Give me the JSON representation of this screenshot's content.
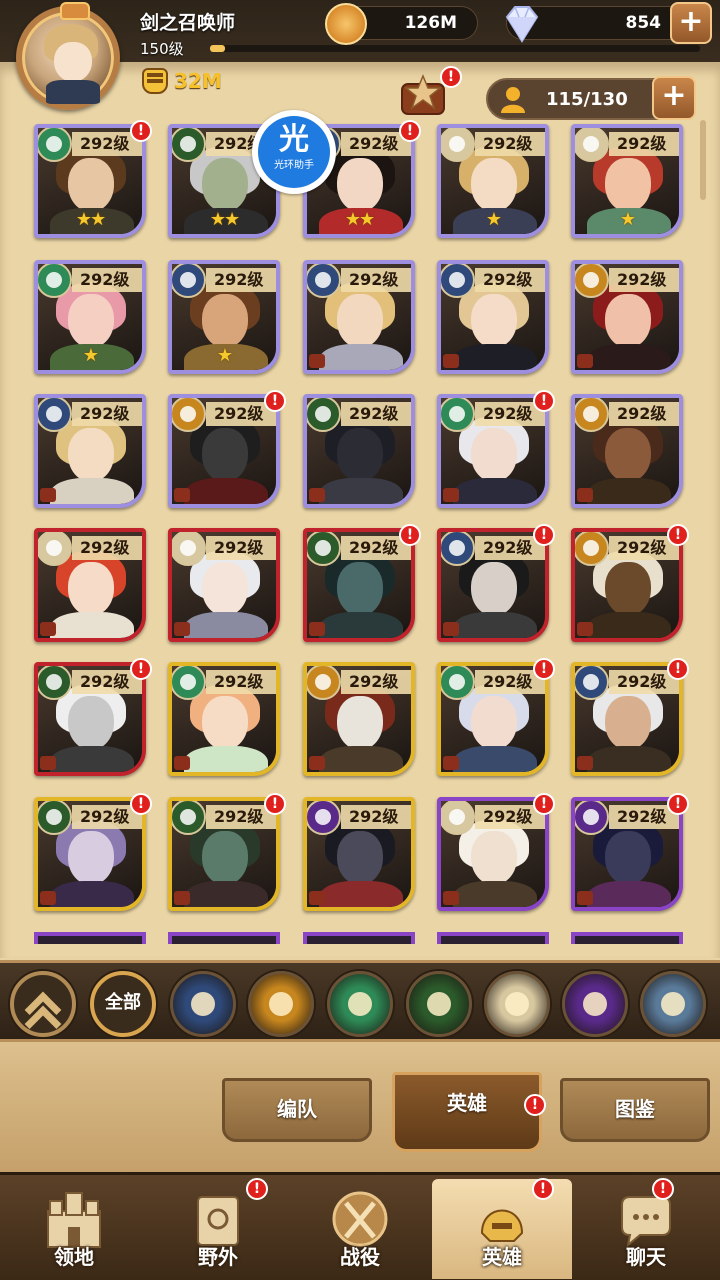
{
  "player": {
    "name": "剑之召唤师",
    "level": "150级",
    "xp_progress": 0.03,
    "power": "32M"
  },
  "currency": {
    "gold": "126M",
    "gems": "854"
  },
  "roster": {
    "capacity": "115/130"
  },
  "watermark": {
    "char": "光",
    "label": "光环助手"
  },
  "heroes": [
    {
      "level": "292级",
      "faction": "forest",
      "frame": "purple",
      "stars": "★★",
      "alert": true,
      "skin": "#e7c7a3",
      "hair": "#5b3a1e",
      "body": "#3d3a2c"
    },
    {
      "level": "292级",
      "faction": "hypogean-eye",
      "frame": "purple",
      "stars": "★★",
      "alert": false,
      "skin": "#a3b08e",
      "hair": "#c8c8c8",
      "body": "#2c2c2c"
    },
    {
      "level": "292级",
      "faction": "lightbearer",
      "frame": "purple",
      "stars": "★★",
      "alert": true,
      "skin": "#f1d7c4",
      "hair": "#1b1410",
      "body": "#b22a2a"
    },
    {
      "level": "292级",
      "faction": "celestial",
      "frame": "purple",
      "stars": "★",
      "alert": false,
      "skin": "#f3dcc3",
      "hair": "#d7b06a",
      "body": "#3a3f55"
    },
    {
      "level": "292级",
      "faction": "celestial",
      "frame": "purple",
      "stars": "★",
      "alert": false,
      "skin": "#f2c2a4",
      "hair": "#b73a2a",
      "body": "#5a8a6a"
    },
    {
      "level": "292级",
      "faction": "forest",
      "frame": "purple",
      "stars": "★",
      "alert": false,
      "skin": "#f5cfc2",
      "hair": "#e89aa8",
      "body": "#4a6a3a"
    },
    {
      "level": "292级",
      "faction": "lightbearer",
      "frame": "purple",
      "stars": "★",
      "alert": false,
      "skin": "#d8a57a",
      "hair": "#6a3e1e",
      "body": "#8a6a30"
    },
    {
      "level": "292级",
      "faction": "lightbearer",
      "frame": "purple",
      "stars": "",
      "alert": false,
      "skin": "#f3d8c0",
      "hair": "#e2c07a",
      "body": "#a8a8b8"
    },
    {
      "level": "292级",
      "faction": "lightbearer",
      "frame": "purple",
      "stars": "",
      "alert": false,
      "skin": "#f4dcc8",
      "hair": "#e2c693",
      "body": "#1e1e26"
    },
    {
      "level": "292级",
      "faction": "mauler",
      "frame": "purple",
      "stars": "",
      "alert": false,
      "skin": "#f0c0a8",
      "hair": "#8c1c1c",
      "body": "#2a1a1a"
    },
    {
      "level": "292级",
      "faction": "lightbearer",
      "frame": "purple",
      "stars": "",
      "alert": false,
      "skin": "#f4dcc2",
      "hair": "#e0c280",
      "body": "#d8d0c0"
    },
    {
      "level": "292级",
      "faction": "mauler",
      "frame": "purple",
      "stars": "",
      "alert": true,
      "skin": "#3a3a3a",
      "hair": "#1e1e1e",
      "body": "#5a1a1a"
    },
    {
      "level": "292级",
      "faction": "hypogean-eye",
      "frame": "purple",
      "stars": "",
      "alert": false,
      "skin": "#2c2c34",
      "hair": "#1e1e26",
      "body": "#3a3a44"
    },
    {
      "level": "292级",
      "faction": "forest",
      "frame": "purple",
      "stars": "",
      "alert": true,
      "skin": "#f2dcd0",
      "hair": "#e8e8ec",
      "body": "#2a2a3a"
    },
    {
      "level": "292级",
      "faction": "mauler",
      "frame": "purple",
      "stars": "",
      "alert": false,
      "skin": "#8a5a3a",
      "hair": "#4a2a1a",
      "body": "#3a2a1a"
    },
    {
      "level": "292级",
      "faction": "celestial",
      "frame": "red",
      "stars": "",
      "alert": false,
      "skin": "#f6dcc8",
      "hair": "#d8442a",
      "body": "#e8e0d0"
    },
    {
      "level": "292级",
      "faction": "celestial",
      "frame": "red",
      "stars": "",
      "alert": false,
      "skin": "#f4e4da",
      "hair": "#e8eaee",
      "body": "#8a8aa0"
    },
    {
      "level": "292级",
      "faction": "hypogean-eye",
      "frame": "red",
      "stars": "",
      "alert": true,
      "skin": "#4a6a6a",
      "hair": "#1a2a2a",
      "body": "#2a3a3a"
    },
    {
      "level": "292级",
      "faction": "lightbearer",
      "frame": "red",
      "stars": "",
      "alert": true,
      "skin": "#d8d0c8",
      "hair": "#1a1a1a",
      "body": "#3a3a3a"
    },
    {
      "level": "292级",
      "faction": "mauler",
      "frame": "red",
      "stars": "",
      "alert": true,
      "skin": "#6a4a2a",
      "hair": "#e8e0cc",
      "body": "#3a2a1a"
    },
    {
      "level": "292级",
      "faction": "hypogean-eye",
      "frame": "red",
      "stars": "",
      "alert": true,
      "skin": "#c8c8c8",
      "hair": "#eeeeee",
      "body": "#3a3a3a"
    },
    {
      "level": "292级",
      "faction": "forest",
      "frame": "gold",
      "stars": "",
      "alert": false,
      "skin": "#f6dcc4",
      "hair": "#f0b080",
      "body": "#cfe6c6"
    },
    {
      "level": "292级",
      "faction": "mauler",
      "frame": "gold",
      "stars": "",
      "alert": false,
      "skin": "#e8e4dc",
      "hair": "#7a2a1a",
      "body": "#4a3a2a"
    },
    {
      "level": "292级",
      "faction": "forest",
      "frame": "gold",
      "stars": "",
      "alert": true,
      "skin": "#f2dcd0",
      "hair": "#d8dcea",
      "body": "#3a4a6a"
    },
    {
      "level": "292级",
      "faction": "lightbearer",
      "frame": "gold",
      "stars": "",
      "alert": true,
      "skin": "#d8b090",
      "hair": "#e8e8e8",
      "body": "#3a2e22"
    },
    {
      "level": "292级",
      "faction": "hypogean-eye",
      "frame": "gold",
      "stars": "",
      "alert": true,
      "skin": "#d8cce0",
      "hair": "#8a7ab0",
      "body": "#3a2a4a"
    },
    {
      "level": "292级",
      "faction": "hypogean-eye",
      "frame": "gold",
      "stars": "",
      "alert": true,
      "skin": "#5a7a6a",
      "hair": "#2a3a2a",
      "body": "#3a2a2a"
    },
    {
      "level": "292级",
      "faction": "hypogean",
      "frame": "gold",
      "stars": "",
      "alert": false,
      "skin": "#4a4a5a",
      "hair": "#1a1a22",
      "body": "#8a2a2a"
    },
    {
      "level": "292级",
      "faction": "celestial",
      "frame": "violet",
      "stars": "",
      "alert": true,
      "skin": "#f0e0d0",
      "hair": "#f4f0e8",
      "body": "#4a3a2a"
    },
    {
      "level": "292级",
      "faction": "hypogean",
      "frame": "violet",
      "stars": "",
      "alert": true,
      "skin": "#3a3a5a",
      "hair": "#1a1a3a",
      "body": "#5a2a5a"
    }
  ],
  "filters": {
    "all_label": "全部",
    "factions": [
      "lightbearer",
      "mauler",
      "forest",
      "hypogean-eye",
      "celestial",
      "hypogean",
      "dimensional"
    ]
  },
  "subtabs": [
    {
      "label": "编队",
      "active": false,
      "alert": false
    },
    {
      "label": "英雄",
      "active": true,
      "alert": true
    },
    {
      "label": "图鉴",
      "active": false,
      "alert": false
    }
  ],
  "nav": [
    {
      "label": "领地",
      "active": false,
      "alert": false
    },
    {
      "label": "野外",
      "active": false,
      "alert": true
    },
    {
      "label": "战役",
      "active": false,
      "alert": false
    },
    {
      "label": "英雄",
      "active": true,
      "alert": true
    },
    {
      "label": "聊天",
      "active": false,
      "alert": true
    }
  ],
  "faction_colors": {
    "lightbearer": "#2f4a7a",
    "mauler": "#c7861e",
    "forest": "#2e8a56",
    "hypogean-eye": "#2b5a2b",
    "celestial": "#d8c8a0",
    "hypogean": "#5a2a8a",
    "dimensional": "#5a7a9a"
  }
}
